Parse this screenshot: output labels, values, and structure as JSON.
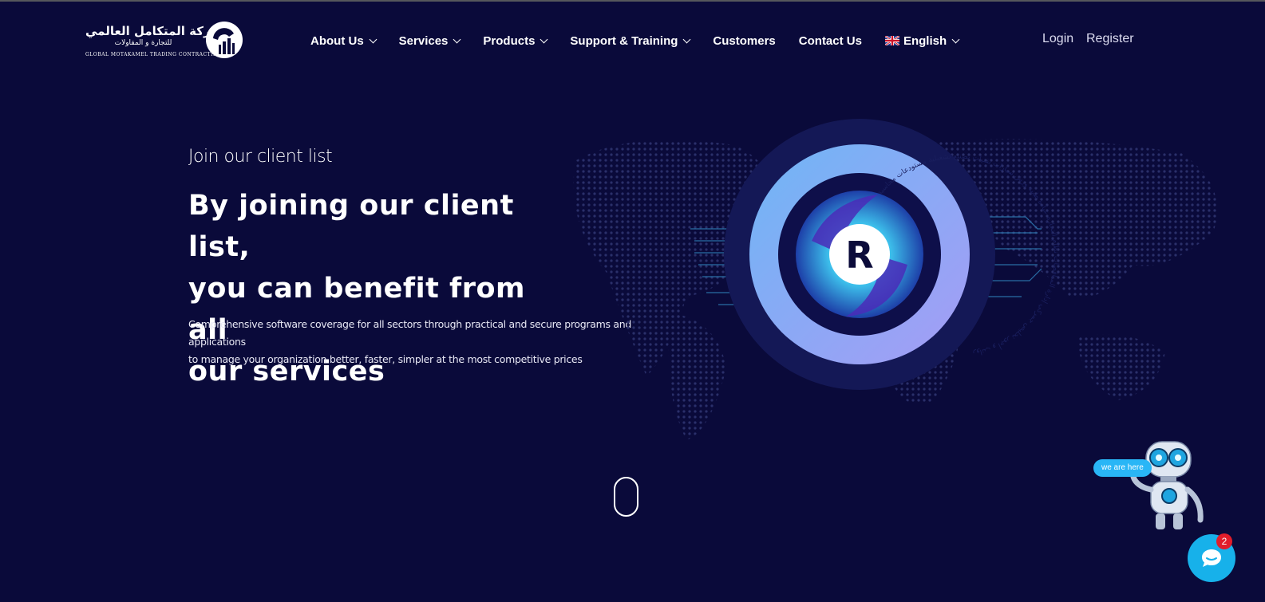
{
  "brand": {
    "name_ar": "شركة المتكامل العالمي",
    "tagline_ar": "للتجارة و المقاولات",
    "name_en": "GLOBAL MOTAKAMEL TRADING CONTRACTING"
  },
  "nav": {
    "items": [
      {
        "label": "About Us",
        "has_dropdown": true
      },
      {
        "label": "Services",
        "has_dropdown": true
      },
      {
        "label": "Products",
        "has_dropdown": true
      },
      {
        "label": "Support & Training",
        "has_dropdown": true
      },
      {
        "label": "Customers",
        "has_dropdown": false
      },
      {
        "label": "Contact Us",
        "has_dropdown": false
      }
    ],
    "language": {
      "label": "English",
      "icon": "uk-flag-icon"
    },
    "login_label": "Login",
    "register_label": "Register"
  },
  "hero": {
    "eyebrow": "Join our client list",
    "headline_lines": [
      "By joining our client list,",
      "you can benefit from all",
      "our services"
    ],
    "description_lines": [
      "Comprehensive software coverage for all sectors through practical and secure programs and applications",
      "to manage your organization better, faster, simpler at the most competitive prices"
    ],
    "emblem_letter": "R",
    "ring_labels": [
      "رواتب و أجور",
      "تخليص جمركي",
      "إدارة المناقصات",
      "نظام التجارة",
      "عيادة طبية",
      "ورش سيارات",
      "تقنيات",
      "تصنيع",
      "تشغيلية",
      "مستودعات",
      "محاسبة مالية",
      "شؤون موظفين"
    ]
  },
  "widgets": {
    "robot_bubble": "we are here",
    "chat_badge_count": "2"
  },
  "colors": {
    "background": "#0a0a3a",
    "accent": "#29b6f6",
    "ring": "#7e8ef0",
    "badge": "#e11d2a"
  }
}
